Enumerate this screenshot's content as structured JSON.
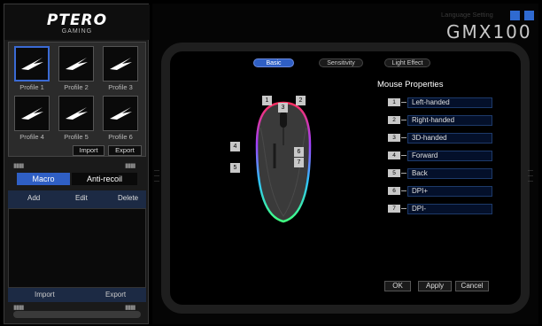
{
  "app": {
    "brand": "PTERO",
    "brand_sub": "GAMING",
    "model": "GMX100",
    "language_setting": "Language Setting"
  },
  "profiles": [
    {
      "label": "Profile 1",
      "active": true
    },
    {
      "label": "Profile 2",
      "active": false
    },
    {
      "label": "Profile 3",
      "active": false
    },
    {
      "label": "Profile 4",
      "active": false
    },
    {
      "label": "Profile 5",
      "active": false
    },
    {
      "label": "Profile 6",
      "active": false
    }
  ],
  "profile_buttons": {
    "import": "Import",
    "export": "Export"
  },
  "macro": {
    "tabs": [
      "Macro",
      "Anti-recoil"
    ],
    "actions": {
      "add": "Add",
      "edit": "Edit",
      "delete": "Delete"
    },
    "bottom": {
      "import": "Import",
      "export": "Export"
    }
  },
  "nav_tabs": {
    "basic": "Basic",
    "sensitivity": "Sensitivity",
    "light_effect": "Light Effect"
  },
  "mouse_properties": {
    "title": "Mouse Properties",
    "rows": [
      {
        "num": "1",
        "value": "Left-handed"
      },
      {
        "num": "2",
        "value": "Right-handed"
      },
      {
        "num": "3",
        "value": "3D-handed"
      },
      {
        "num": "4",
        "value": "Forward"
      },
      {
        "num": "5",
        "value": "Back"
      },
      {
        "num": "6",
        "value": "DPI+"
      },
      {
        "num": "7",
        "value": "DPI-"
      }
    ]
  },
  "mouse_buttons": [
    "1",
    "2",
    "3",
    "4",
    "5",
    "6",
    "7"
  ],
  "actions": {
    "ok": "OK",
    "apply": "Apply",
    "cancel": "Cancel"
  },
  "colors": {
    "accent": "#2f5fc4",
    "panel": "#1a1a1a",
    "field_bg": "#04102a"
  }
}
